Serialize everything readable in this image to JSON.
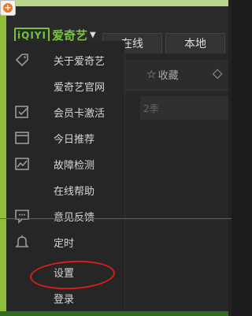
{
  "logo": {
    "mark": "iQIYI",
    "name": "爱奇艺"
  },
  "tabs": [
    "在线",
    "本地"
  ],
  "toolbar": {
    "favorites": "收藏",
    "season": "2季"
  },
  "menu": [
    {
      "label": "关于爱奇艺",
      "icon": "tag-icon"
    },
    {
      "label": "爱奇艺官网",
      "icon": ""
    },
    {
      "label": "会员卡激活",
      "icon": "card-check-icon"
    },
    {
      "label": "今日推荐",
      "icon": "calendar-icon"
    },
    {
      "label": "故障检测",
      "icon": "chart-icon"
    },
    {
      "label": "在线帮助",
      "icon": ""
    },
    {
      "label": "意见反馈",
      "icon": "feedback-icon"
    },
    {
      "label": "定时",
      "icon": "bell-icon"
    },
    {
      "label": "设置",
      "icon": ""
    },
    {
      "label": "登录",
      "icon": ""
    }
  ],
  "colors": {
    "brand": "#7ac142",
    "annotation": "#d21f1f"
  }
}
